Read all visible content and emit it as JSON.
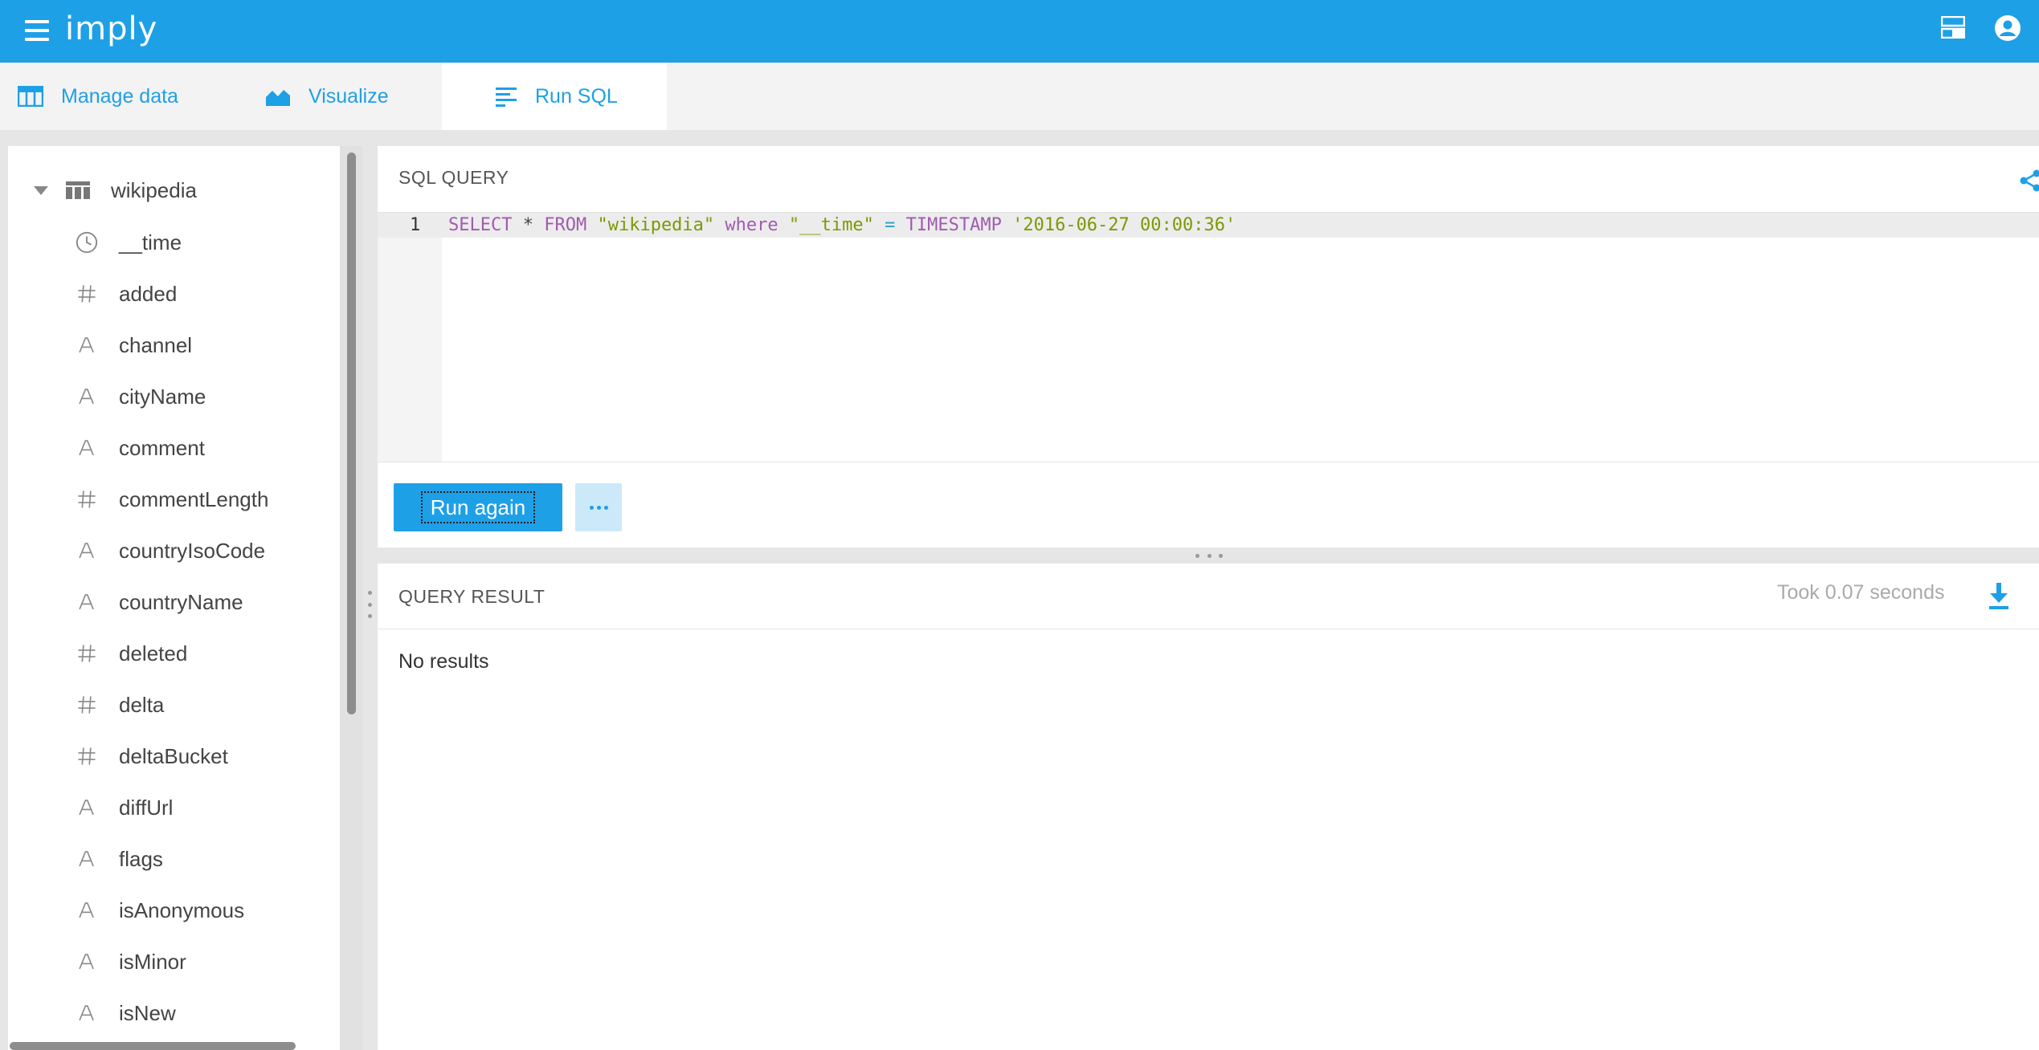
{
  "app": {
    "logo": "imply",
    "icons": {
      "menu": "hamburger-icon",
      "layout": "layout-icon",
      "user": "user-circle-icon"
    },
    "accent_color": "#1ea0e6"
  },
  "tabs": [
    {
      "label": "Manage data",
      "icon": "table-icon",
      "active": false
    },
    {
      "label": "Visualize",
      "icon": "area-chart-icon",
      "active": false
    },
    {
      "label": "Run SQL",
      "icon": "align-left-icon",
      "active": true
    }
  ],
  "sidebar": {
    "datasource": "wikipedia",
    "columns": [
      {
        "name": "__time",
        "type": "time"
      },
      {
        "name": "added",
        "type": "number"
      },
      {
        "name": "channel",
        "type": "string"
      },
      {
        "name": "cityName",
        "type": "string"
      },
      {
        "name": "comment",
        "type": "string"
      },
      {
        "name": "commentLength",
        "type": "number"
      },
      {
        "name": "countryIsoCode",
        "type": "string"
      },
      {
        "name": "countryName",
        "type": "string"
      },
      {
        "name": "deleted",
        "type": "number"
      },
      {
        "name": "delta",
        "type": "number"
      },
      {
        "name": "deltaBucket",
        "type": "number"
      },
      {
        "name": "diffUrl",
        "type": "string"
      },
      {
        "name": "flags",
        "type": "string"
      },
      {
        "name": "isAnonymous",
        "type": "string"
      },
      {
        "name": "isMinor",
        "type": "string"
      },
      {
        "name": "isNew",
        "type": "string"
      }
    ]
  },
  "query": {
    "title": "SQL QUERY",
    "line_number": "1",
    "code_tokens": [
      {
        "text": "SELECT",
        "cls": "kw"
      },
      {
        "text": " * ",
        "cls": ""
      },
      {
        "text": "FROM",
        "cls": "kw"
      },
      {
        "text": " ",
        "cls": ""
      },
      {
        "text": "\"wikipedia\"",
        "cls": "str"
      },
      {
        "text": " ",
        "cls": ""
      },
      {
        "text": "where",
        "cls": "kw"
      },
      {
        "text": " ",
        "cls": ""
      },
      {
        "text": "\"__time\"",
        "cls": "str"
      },
      {
        "text": " ",
        "cls": ""
      },
      {
        "text": "=",
        "cls": "op"
      },
      {
        "text": " ",
        "cls": ""
      },
      {
        "text": "TIMESTAMP",
        "cls": "kw"
      },
      {
        "text": " ",
        "cls": ""
      },
      {
        "text": "'2016-06-27 00:00:36'",
        "cls": "str"
      }
    ],
    "run_label": "Run again"
  },
  "result": {
    "title": "QUERY RESULT",
    "timing": "Took 0.07 seconds",
    "empty_message": "No results"
  }
}
